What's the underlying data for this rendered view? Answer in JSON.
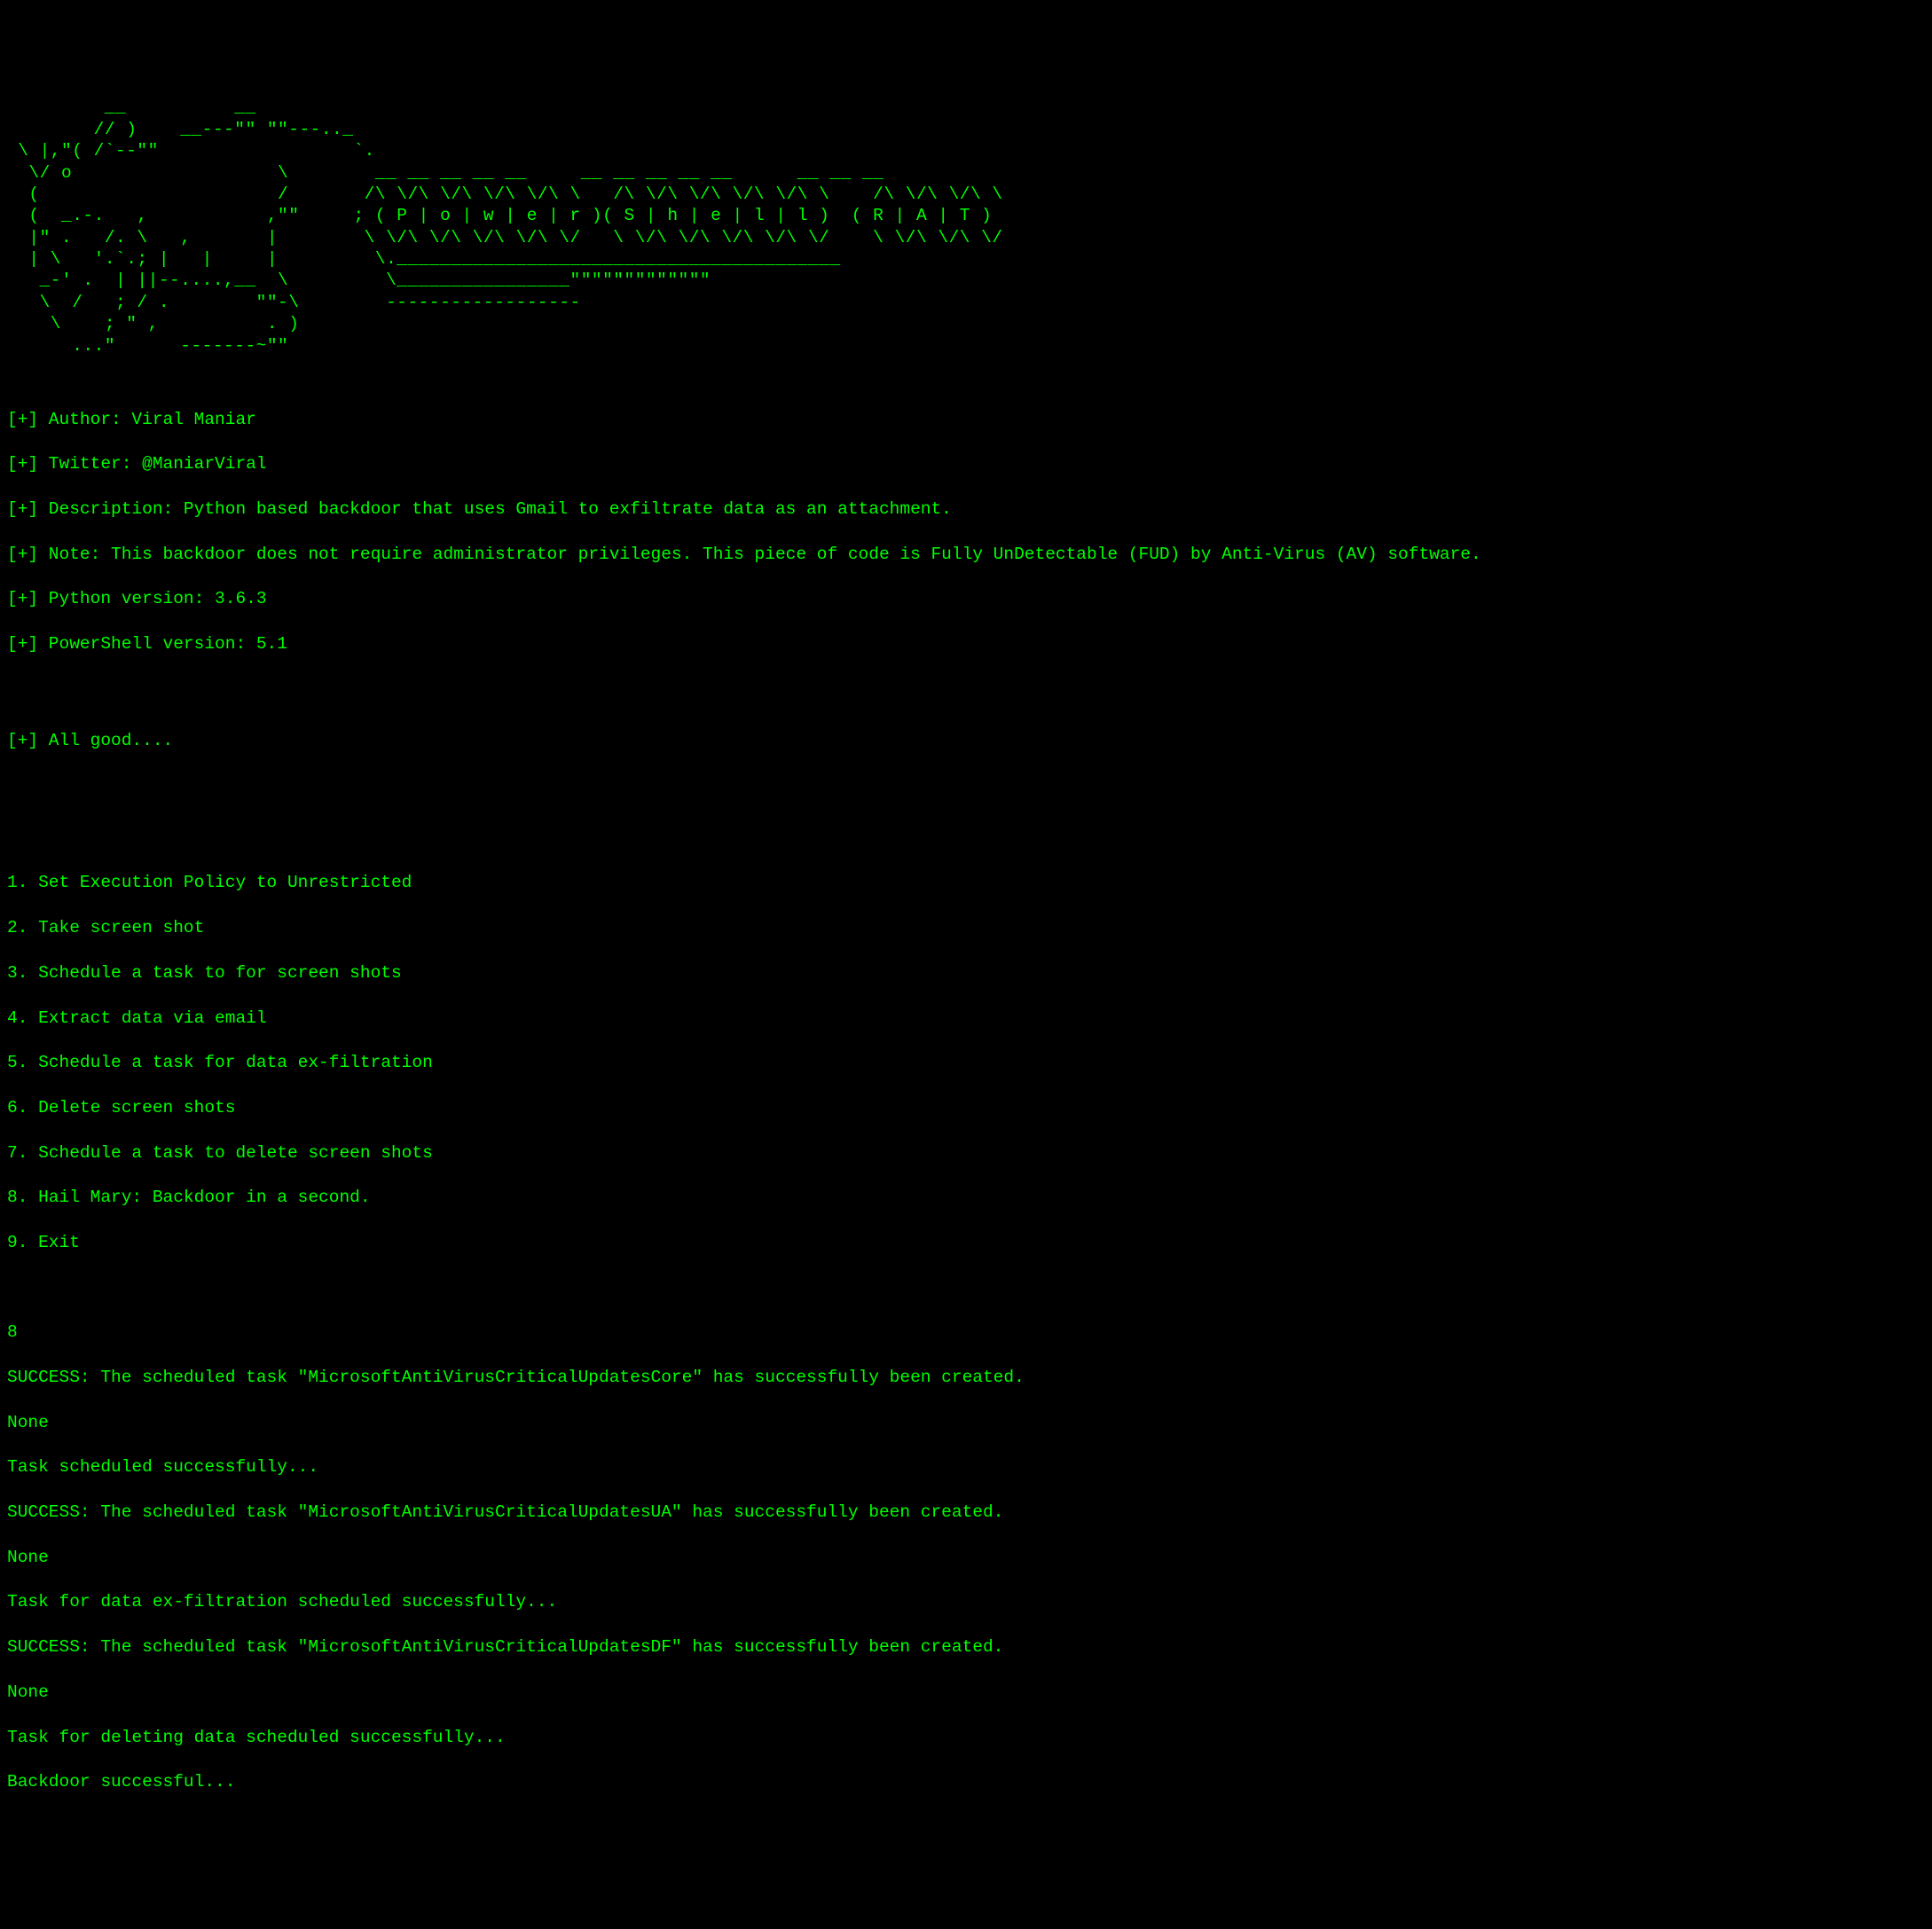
{
  "ascii_art": "         __          __   \n        // )    __---\"\" \"\"---.._\n \\ |,\"( /`--\"\"                  `.\n  \\/ o                   \\        __ __ __ __ __     __ __ __ __ __      __ __ __\n  (                      /       /\\ \\/\\ \\/\\ \\/\\ \\/\\ \\   /\\ \\/\\ \\/\\ \\/\\ \\/\\ \\    /\\ \\/\\ \\/\\ \\\n  (  _.-.   ,           ,\"\"     ; ( P | o | w | e | r )( S | h | e | l | l )  ( R | A | T )\n  |\" .   /. \\   ,       |        \\ \\/\\ \\/\\ \\/\\ \\/\\ \\/   \\ \\/\\ \\/\\ \\/\\ \\/\\ \\/    \\ \\/\\ \\/\\ \\/\n  | \\   '.`.; |   |     |         \\._________________________________________\n   _-' .  | ||--....,__  \\         \\________________\"\"\"\"\"\"\"\"\"\"\"\"\"\n   \\  /   ; / .        \"\"-\\        ------------------\n    \\    ; \" ,          . )\n      ...\"      -------~\"\"",
  "info": [
    "[+] Author: Viral Maniar",
    "[+] Twitter: @ManiarViral",
    "[+] Description: Python based backdoor that uses Gmail to exfiltrate data as an attachment.",
    "[+] Note: This backdoor does not require administrator privileges. This piece of code is Fully UnDetectable (FUD) by Anti-Virus (AV) software.",
    "[+] Python version: 3.6.3",
    "[+] PowerShell version: 5.1"
  ],
  "status": "[+] All good....",
  "menu": [
    "1. Set Execution Policy to Unrestricted",
    "2. Take screen shot",
    "3. Schedule a task to for screen shots",
    "4. Extract data via email",
    "5. Schedule a task for data ex-filtration",
    "6. Delete screen shots",
    "7. Schedule a task to delete screen shots",
    "8. Hail Mary: Backdoor in a second.",
    "9. Exit"
  ],
  "input_choice": "8",
  "output": [
    "SUCCESS: The scheduled task \"MicrosoftAntiVirusCriticalUpdatesCore\" has successfully been created.",
    "None",
    "Task scheduled successfully...",
    "SUCCESS: The scheduled task \"MicrosoftAntiVirusCriticalUpdatesUA\" has successfully been created.",
    "None",
    "Task for data ex-filtration scheduled successfully...",
    "SUCCESS: The scheduled task \"MicrosoftAntiVirusCriticalUpdatesDF\" has successfully been created.",
    "None",
    "Task for deleting data scheduled successfully...",
    "Backdoor successful..."
  ]
}
